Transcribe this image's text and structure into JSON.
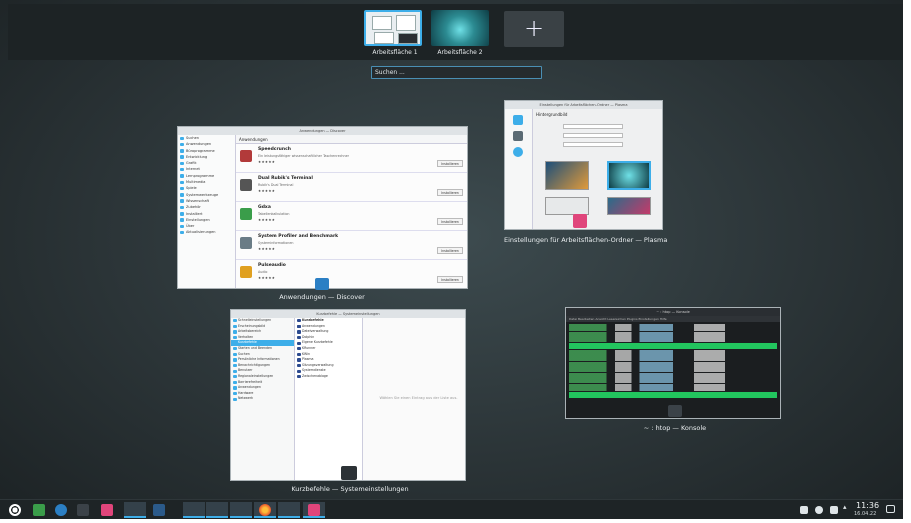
{
  "desktops": {
    "items": [
      {
        "label": "Arbeitsfläche 1"
      },
      {
        "label": "Arbeitsfläche 2"
      }
    ],
    "add_label": "+"
  },
  "search": {
    "placeholder": "Suchen ..."
  },
  "windows": {
    "discover": {
      "caption": "Anwendungen — Discover",
      "title": "Anwendungen — Discover",
      "header": "Anwendungen",
      "sidebar": [
        "Suchen",
        "Anwendungen",
        "Büroprogramme",
        "Entwicklung",
        "Grafik",
        "Internet",
        "Lernprogramme",
        "Multimedia",
        "Spiele",
        "Systemwerkzeuge",
        "Wissenschaft",
        "Zubehör",
        "Installiert",
        "Einstellungen",
        "Über",
        "Aktualisierungen"
      ],
      "apps": [
        {
          "name": "Speedcrunch",
          "desc": "Ein leistungsfähiger wissenschaftlicher Taschenrechner",
          "button": "Installieren",
          "color": "#b23a3a"
        },
        {
          "name": "Dual Rubik's Terminal",
          "desc": "Rubik's Dual Terminal",
          "button": "Installieren",
          "color": "#555555"
        },
        {
          "name": "Gdxa",
          "desc": "Tabellenkalkulation",
          "button": "Installieren",
          "color": "#3a9d4a"
        },
        {
          "name": "System Profiler and Benchmark",
          "desc": "Systeminformationen",
          "button": "Installieren",
          "color": "#6a7c86"
        },
        {
          "name": "Pulseaudio",
          "desc": "Audio",
          "button": "Installieren",
          "color": "#e0a020"
        }
      ],
      "stars": "★★★★★"
    },
    "plasma": {
      "caption": "Einstellungen für Arbeitsflächen-Ordner — Plasma",
      "title": "Einstellungen für Arbeitsflächen-Ordner — Plasma",
      "heading": "Hintergrundbild"
    },
    "konsole": {
      "caption": "~ : htop — Konsole",
      "title": "~ : htop — Konsole",
      "menu": "Datei  Bearbeiten  Ansicht  Lesezeichen  Plugins  Einstellungen  Hilfe"
    },
    "sysset": {
      "caption": "Kurzbefehle — Systemeinstellungen",
      "title": "Kurzbefehle — Systemeinstellungen",
      "header": "Kurzbefehle",
      "sidebar": [
        "Schnelleinstellungen",
        "Erscheinungsbild",
        "Arbeitsbereich",
        "Verhalten",
        "Kurzbefehle",
        "Starten und Beenden",
        "Suchen",
        "Persönliche Informationen",
        "Benachrichtigungen",
        "Benutzer",
        "Regionaleinstellungen",
        "Barrierefreiheit",
        "Anwendungen",
        "Hardware",
        "Netzwerk"
      ],
      "list": [
        "Anwendungen",
        "Dateiverwaltung",
        "Dolphin",
        "Eigene Kurzbefehle",
        "KRunner",
        "KWin",
        "Plasma",
        "Sitzungsverwaltung",
        "Systemdienste",
        "Zwischenablage"
      ],
      "placeholder": "Wählen Sie einen Eintrag aus der Liste aus."
    }
  },
  "taskbar": {
    "time": "11:36",
    "date": "16.04.22"
  },
  "colors": {
    "accent": "#3daee9",
    "konsole_green": "#22c55e"
  }
}
